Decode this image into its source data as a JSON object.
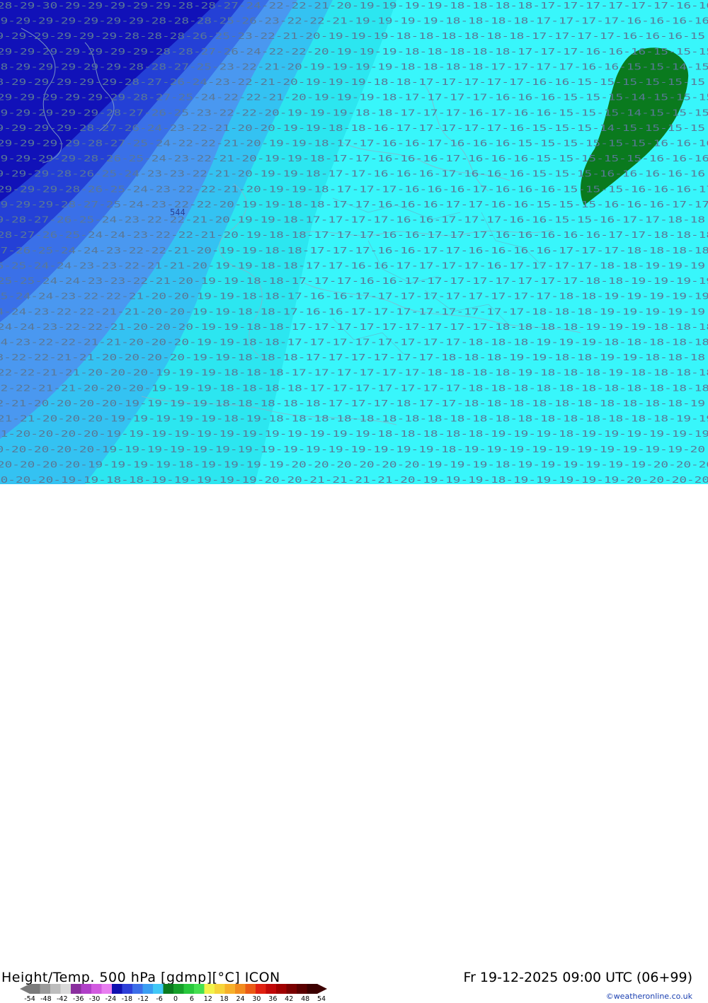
{
  "map": {
    "pressure_level_label": "544",
    "colors": {
      "deep": "#1111b8",
      "blue1": "#2440d6",
      "blue2": "#3a70e8",
      "blue3": "#4a98f0",
      "sky": "#34c2f2",
      "cyan": "#2ce6f0",
      "light": "#38f6fb",
      "green": "#0a7a1e"
    },
    "contour_rows": [
      {
        "labels": "28-29-30-29-29-29-29-29-28-28-27-24-22-22-21-20-19-19-19-19-18-18-18-18-17-17-17-17-17-17-16-16"
      },
      {
        "labels": "29-29-29-29-29-29-29-28-28-28-25-26-23-22-22-21-19-19-19-19-18-18-18-18-17-17-17-17-16-16-16-16"
      },
      {
        "labels": "29-29-29-29-29-29-28-28-28-26-25-23-22-21-20-19-19-19-18-18-18-18-18-18-17-17-17-17-16-16-16-15"
      },
      {
        "labels": "29-29-29-29-29-29-29-28-28-27-26-24-22-22-20-19-19-19-18-18-18-18-18-17-17-17-16-16-16-15-15-15"
      },
      {
        "labels": "28-29-29-29-29-29-28-28-27-25-23-22-21-20-19-19-19-19-18-18-18-18-17-17-17-17-16-16-15-15-14-15"
      },
      {
        "labels": "28-29-29-29-29-29-28-27-26-24-23-22-21-20-19-19-19-18-18-17-17-17-17-17-16-16-15-15-15-15-15-15"
      },
      {
        "labels": "29-29-29-29-29-29-28-27-25-24-22-22-21-20-19-19-19-18-17-17-17-17-16-16-16-15-15-15-14-15-15-15"
      },
      {
        "labels": "29-29-29-29-29-28-27-26-25-23-22-22-20-19-19-19-18-18-17-17-17-16-17-16-16-15-15-15-14-15-15-15"
      },
      {
        "labels": "29-29-29-29-28-27-26-24-23-22-21-20-20-19-19-18-18-16-17-17-17-17-17-16-15-15-15-14-15-15-15-15"
      },
      {
        "labels": "29-29-29-29-28-27-25-24-22-22-21-20-19-19-18-17-17-16-16-17-16-16-16-15-15-15-15-15-15-16-16-16"
      },
      {
        "labels": "29-29-29-29-28-26-25-24-23-22-21-20-19-19-18-17-17-16-16-16-17-16-16-16-15-15-15-15-15-16-16-16"
      },
      {
        "labels": "29-29-29-28-26-25-24-23-23-22-21-20-19-19-18-17-17-16-16-16-17-16-16-16-15-15-15-16-16-16-16-16"
      },
      {
        "labels": "29-29-29-28-26-25-24-23-22-22-21-20-19-19-18-17-17-17-16-16-16-17-16-16-16-15-15-15-16-16-16-17"
      },
      {
        "labels": "29-29-29-28-27-25-24-23-22-22-20-19-19-18-18-17-17-16-16-16-17-17-16-16-15-15-15-16-16-16-17-17"
      },
      {
        "labels": "29-28-27-26-25-24-23-22-22-21-20-19-19-18-17-17-17-17-16-16-17-17-17-16-16-15-15-16-17-17-18-18"
      },
      {
        "labels": "28-27-26-25-24-24-23-22-22-21-20-19-18-18-17-17-17-16-16-17-17-17-16-16-16-16-16-17-17-18-18-18"
      },
      {
        "labels": "27-26-25-24-24-23-22-22-21-20-19-19-18-18-17-17-17-16-16-17-17-16-16-16-16-17-17-17-18-18-18-18"
      },
      {
        "labels": "26-25-24-24-23-23-22-21-21-20-19-19-18-18-17-17-16-16-17-17-17-17-16-17-17-17-17-18-18-19-19-19"
      },
      {
        "labels": "25-25-24-24-23-23-22-21-20-19-19-18-18-17-17-17-16-16-17-17-17-17-17-17-17-17-18-18-19-19-19-19"
      },
      {
        "labels": "25-24-24-23-22-22-21-20-20-19-19-18-18-17-16-16-17-17-17-17-17-17-17-17-17-18-18-19-19-19-19-19"
      },
      {
        "labels": "24-24-23-22-22-21-21-20-20-19-19-18-18-17-16-16-17-17-17-17-17-17-17-17-18-18-18-19-19-19-19-19"
      },
      {
        "labels": "24-24-23-22-22-21-20-20-20-19-19-18-18-17-17-17-17-17-17-17-17-17-18-18-18-18-19-19-19-18-18-18"
      },
      {
        "labels": "24-23-22-22-21-21-20-20-20-19-19-18-18-17-17-17-17-17-17-17-17-18-18-18-19-19-19-18-18-18-18-18"
      },
      {
        "labels": "23-22-22-21-21-20-20-20-20-19-19-18-18-18-17-17-17-17-17-17-18-18-18-19-19-18-18-19-19-18-18-18"
      },
      {
        "labels": "22-22-21-21-20-20-20-19-19-19-18-18-18-17-17-17-17-17-17-18-18-18-18-19-18-18-18-19-18-18-18-18"
      },
      {
        "labels": "22-22-21-21-20-20-20-19-19-19-18-18-18-18-17-17-17-17-17-17-17-18-18-18-18-18-18-18-18-18-18-18"
      },
      {
        "labels": "22-21-20-20-20-20-19-19-19-19-18-18-18-18-18-17-17-17-18-17-17-18-18-18-18-18-18-18-18-18-18-19"
      },
      {
        "labels": "21-21-20-20-20-19-19-19-19-19-18-19-18-18-18-18-18-18-18-18-18-18-18-18-18-18-18-18-18-18-19-19"
      },
      {
        "labels": "21-20-20-20-20-19-19-19-19-19-19-19-19-19-19-19-19-18-18-18-18-18-19-19-19-18-19-19-19-19-19-19"
      },
      {
        "labels": "20-20-20-20-20-19-19-19-19-19-19-19-19-19-19-19-19-19-19-19-18-19-19-19-19-19-19-19-19-19-19-20"
      },
      {
        "labels": "20-20-20-20-19-19-19-19-18-19-19-19-19-20-20-20-20-20-20-19-19-19-18-19-19-19-19-19-19-20-20-20"
      },
      {
        "labels": "20-20-20-19-19-18-18-19-19-19-19-19-20-20-21-21-21-21-20-19-19-19-18-19-19-19-19-19-20-20-20-20"
      }
    ]
  },
  "footer": {
    "title": "Height/Temp. 500 hPa [gdmp][°C] ICON",
    "datetime": "Fr 19-12-2025 09:00 UTC (06+99)",
    "credit": "©weatheronline.co.uk"
  },
  "legend": {
    "ticks": [
      "-54",
      "-48",
      "-42",
      "-36",
      "-30",
      "-24",
      "-18",
      "-12",
      "-6",
      "0",
      "6",
      "12",
      "18",
      "24",
      "30",
      "36",
      "42",
      "48",
      "54"
    ],
    "colors": [
      "#7a7a7a",
      "#9a9a9a",
      "#bdbdbd",
      "#d9d9d9",
      "#8a2f9e",
      "#b03fc8",
      "#d25ae0",
      "#e87ef0",
      "#1010b0",
      "#2d3fd8",
      "#3c6ee8",
      "#3a9ef2",
      "#40c8f6",
      "#0a7a1e",
      "#16a02a",
      "#28c83c",
      "#45e050",
      "#f2f24a",
      "#f6d43a",
      "#f6b02a",
      "#f28c1e",
      "#ea5a14",
      "#e02010",
      "#c00808",
      "#a00000",
      "#7a0000",
      "#5a0000",
      "#3c0000"
    ]
  }
}
